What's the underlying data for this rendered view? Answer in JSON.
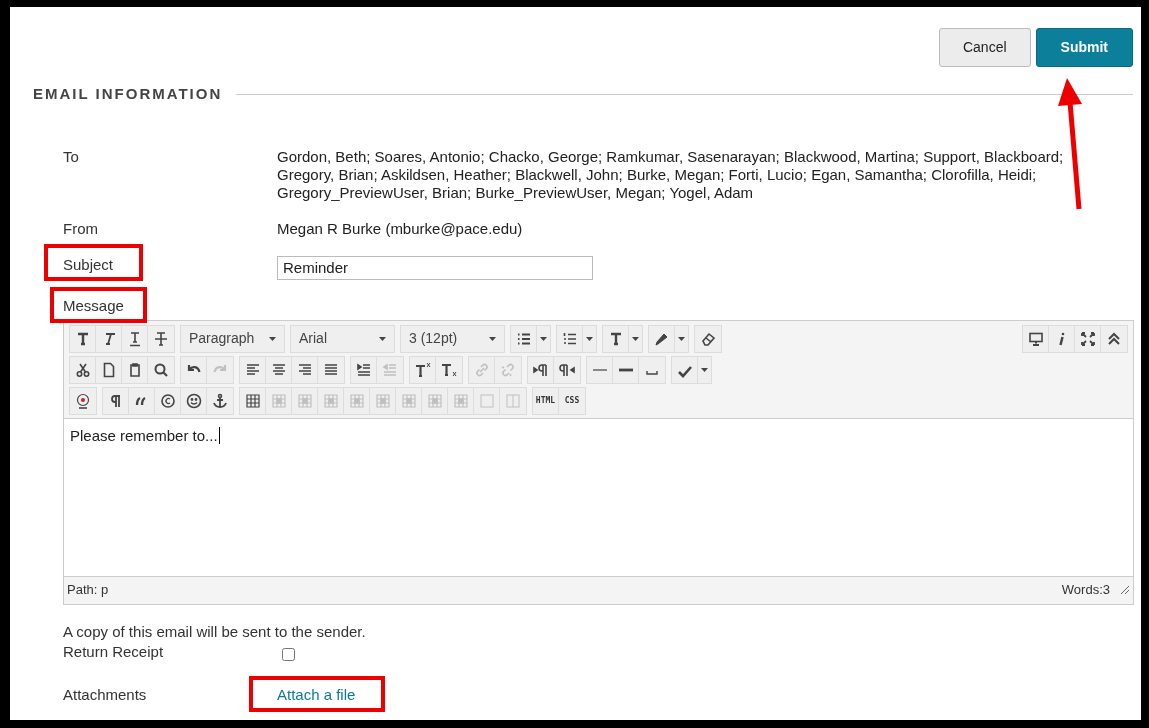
{
  "actions": [
    {
      "label": "Cancel",
      "kind": "secondary"
    },
    {
      "label": "Submit",
      "kind": "primary"
    }
  ],
  "section_title": "EMAIL INFORMATION",
  "fields": [
    {
      "label": "To",
      "value": "Gordon, Beth; Soares, Antonio; Chacko, George; Ramkumar, Sasenarayan; Blackwood, Martina; Support, Blackboard; Gregory, Brian; Askildsen, Heather; Blackwell, John; Burke, Megan; Forti, Lucio; Egan, Samantha; Clorofilla, Heidi; Gregory_PreviewUser, Brian; Burke_PreviewUser, Megan; Yogel, Adam",
      "kind": "text"
    },
    {
      "label": "From",
      "value": "Megan R Burke (mburke@pace.edu)",
      "kind": "text"
    },
    {
      "label": "Subject",
      "value": "Reminder",
      "kind": "input"
    }
  ],
  "message_label": "Message",
  "toolbar": {
    "rows": [
      {
        "groups": [
          {
            "items": [
              {
                "kind": "icon",
                "disabled": false
              },
              {
                "kind": "icon",
                "disabled": false
              },
              {
                "kind": "icon",
                "disabled": false
              },
              {
                "kind": "icon",
                "disabled": false
              }
            ]
          },
          {
            "items": [
              {
                "kind": "select",
                "value": "Paragraph"
              }
            ]
          },
          {
            "items": [
              {
                "kind": "select",
                "value": "Arial"
              }
            ]
          },
          {
            "items": [
              {
                "kind": "select",
                "value": "3 (12pt)"
              }
            ]
          },
          {
            "items": [
              {
                "kind": "split",
                "disabled": false
              }
            ]
          },
          {
            "items": [
              {
                "kind": "split",
                "disabled": false
              }
            ]
          },
          {
            "items": [
              {
                "kind": "split",
                "disabled": false
              }
            ]
          },
          {
            "items": [
              {
                "kind": "split",
                "disabled": false
              }
            ]
          },
          {
            "items": [
              {
                "kind": "icon",
                "disabled": false
              }
            ]
          }
        ],
        "right_groups": [
          {
            "items": [
              {
                "kind": "icon",
                "disabled": false
              },
              {
                "kind": "icon",
                "disabled": false
              },
              {
                "kind": "icon",
                "disabled": false
              },
              {
                "kind": "icon",
                "disabled": false
              }
            ]
          }
        ]
      },
      {
        "groups": [
          {
            "items": [
              {
                "kind": "icon",
                "disabled": false
              },
              {
                "kind": "icon",
                "disabled": false
              },
              {
                "kind": "icon",
                "disabled": false
              },
              {
                "kind": "icon",
                "disabled": false
              }
            ]
          },
          {
            "items": [
              {
                "kind": "icon",
                "disabled": false
              },
              {
                "kind": "icon",
                "disabled": true
              }
            ]
          },
          {
            "items": [
              {
                "kind": "icon",
                "disabled": false
              },
              {
                "kind": "icon",
                "disabled": false
              },
              {
                "kind": "icon",
                "disabled": false
              },
              {
                "kind": "icon",
                "disabled": false
              }
            ]
          },
          {
            "items": [
              {
                "kind": "icon",
                "disabled": false
              },
              {
                "kind": "icon",
                "disabled": true
              }
            ]
          },
          {
            "items": [
              {
                "kind": "icon",
                "disabled": false
              },
              {
                "kind": "icon",
                "disabled": false
              }
            ]
          },
          {
            "items": [
              {
                "kind": "icon",
                "disabled": true
              },
              {
                "kind": "icon",
                "disabled": true
              }
            ]
          },
          {
            "items": [
              {
                "kind": "icon",
                "disabled": false
              },
              {
                "kind": "icon",
                "disabled": false
              }
            ]
          },
          {
            "items": [
              {
                "kind": "icon",
                "disabled": false
              },
              {
                "kind": "icon",
                "disabled": false
              },
              {
                "kind": "icon",
                "disabled": false
              }
            ]
          },
          {
            "items": [
              {
                "kind": "split",
                "disabled": false
              }
            ]
          }
        ]
      },
      {
        "groups": [
          {
            "items": [
              {
                "kind": "icon",
                "disabled": false
              }
            ]
          },
          {
            "items": [
              {
                "kind": "icon",
                "disabled": false
              },
              {
                "kind": "icon",
                "disabled": false
              },
              {
                "kind": "icon",
                "disabled": false
              },
              {
                "kind": "icon",
                "disabled": false
              },
              {
                "kind": "icon",
                "disabled": false
              }
            ]
          },
          {
            "items": [
              {
                "kind": "icon",
                "disabled": false
              },
              {
                "kind": "icon",
                "disabled": true
              },
              {
                "kind": "icon",
                "disabled": true
              },
              {
                "kind": "icon",
                "disabled": true
              },
              {
                "kind": "icon",
                "disabled": true
              },
              {
                "kind": "icon",
                "disabled": true
              },
              {
                "kind": "icon",
                "disabled": true
              },
              {
                "kind": "icon",
                "disabled": true
              },
              {
                "kind": "icon",
                "disabled": true
              },
              {
                "kind": "icon",
                "disabled": true
              },
              {
                "kind": "icon",
                "disabled": true
              }
            ]
          },
          {
            "items": [
              {
                "kind": "text",
                "label": "HTML"
              },
              {
                "kind": "text",
                "label": "CSS"
              }
            ]
          }
        ]
      }
    ]
  },
  "editor_text": "Please remember to...",
  "path": "Path: p",
  "word_count": "Words:3",
  "copy_notice": "A copy of this email will be sent to the sender.",
  "return_receipt": {
    "label": "Return Receipt",
    "checked": false
  },
  "attachments": {
    "label": "Attachments",
    "link": "Attach a file"
  },
  "annotations": [
    {
      "kind": "box"
    },
    {
      "kind": "box"
    },
    {
      "kind": "box"
    },
    {
      "kind": "arrow"
    }
  ]
}
